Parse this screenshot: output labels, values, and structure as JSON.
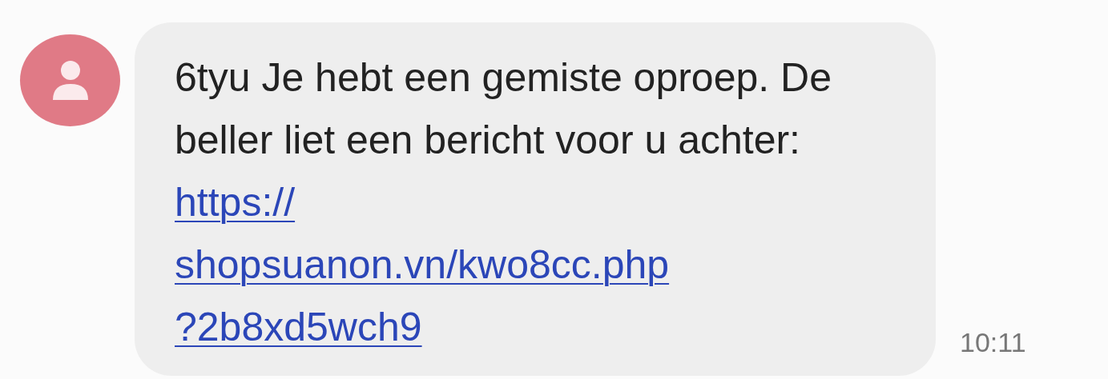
{
  "message": {
    "text": "6tyu Je hebt een gemiste oproep. De beller liet een bericht voor u achter:",
    "link_lines": [
      "https://",
      "shopsuanon.vn/kwo8cc.php",
      "?2b8xd5wch9"
    ],
    "time": "10:11"
  }
}
